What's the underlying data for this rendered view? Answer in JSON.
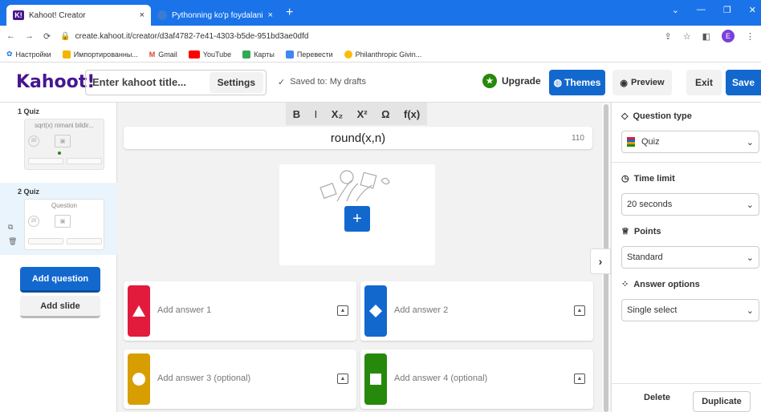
{
  "browser": {
    "tabs": [
      {
        "favicon": "K!",
        "title": "Kahoot! Creator",
        "close": "×"
      },
      {
        "favicon": "",
        "title": "Pythonning ko'p foydalaniladiga",
        "close": "×"
      }
    ],
    "new_tab": "+",
    "url": "create.kahoot.it/creator/d3af4782-7e41-4303-b5de-951bd3ae0dfd",
    "profile_initial": "E",
    "bookmarks": [
      {
        "label": "Настройки",
        "color": "#1a73e8"
      },
      {
        "label": "Импортированны...",
        "color": "#f4b400"
      },
      {
        "label": "Gmail",
        "color": "#db4437"
      },
      {
        "label": "YouTube",
        "color": "#ff0000"
      },
      {
        "label": "Карты",
        "color": "#34a853"
      },
      {
        "label": "Перевести",
        "color": "#4285f4"
      },
      {
        "label": "Philanthropic Givin...",
        "color": "#fbbc05"
      }
    ]
  },
  "header": {
    "logo": "Kahoot!",
    "title_placeholder": "Enter kahoot title...",
    "settings": "Settings",
    "saved_status": "Saved to: My drafts",
    "upgrade": "Upgrade",
    "themes": "Themes",
    "preview": "Preview",
    "exit": "Exit",
    "save": "Save"
  },
  "sidebar": {
    "slides": [
      {
        "label": "1  Quiz",
        "question": "sqrt(x) nimani bildir...",
        "timer": "20"
      },
      {
        "label": "2  Quiz",
        "question": "Question",
        "timer": "20"
      }
    ],
    "add_question": "Add question",
    "add_slide": "Add slide"
  },
  "editor": {
    "toolbar": {
      "bold": "B",
      "italic": "I",
      "subscript": "X₂",
      "superscript": "X²",
      "omega": "Ω",
      "fx": "f(x)"
    },
    "question_text": "round(x,n)",
    "char_count": "110",
    "answers": [
      {
        "placeholder": "Add answer 1",
        "color": "#e21b3c",
        "shape": "triangle"
      },
      {
        "placeholder": "Add answer 2",
        "color": "#1368ce",
        "shape": "diamond"
      },
      {
        "placeholder": "Add answer 3 (optional)",
        "color": "#d89e00",
        "shape": "circle"
      },
      {
        "placeholder": "Add answer 4 (optional)",
        "color": "#26890c",
        "shape": "square"
      }
    ]
  },
  "right_panel": {
    "question_type": {
      "label": "Question type",
      "value": "Quiz"
    },
    "time_limit": {
      "label": "Time limit",
      "value": "20 seconds"
    },
    "points": {
      "label": "Points",
      "value": "Standard"
    },
    "answer_options": {
      "label": "Answer options",
      "value": "Single select"
    },
    "delete": "Delete",
    "duplicate": "Duplicate"
  }
}
